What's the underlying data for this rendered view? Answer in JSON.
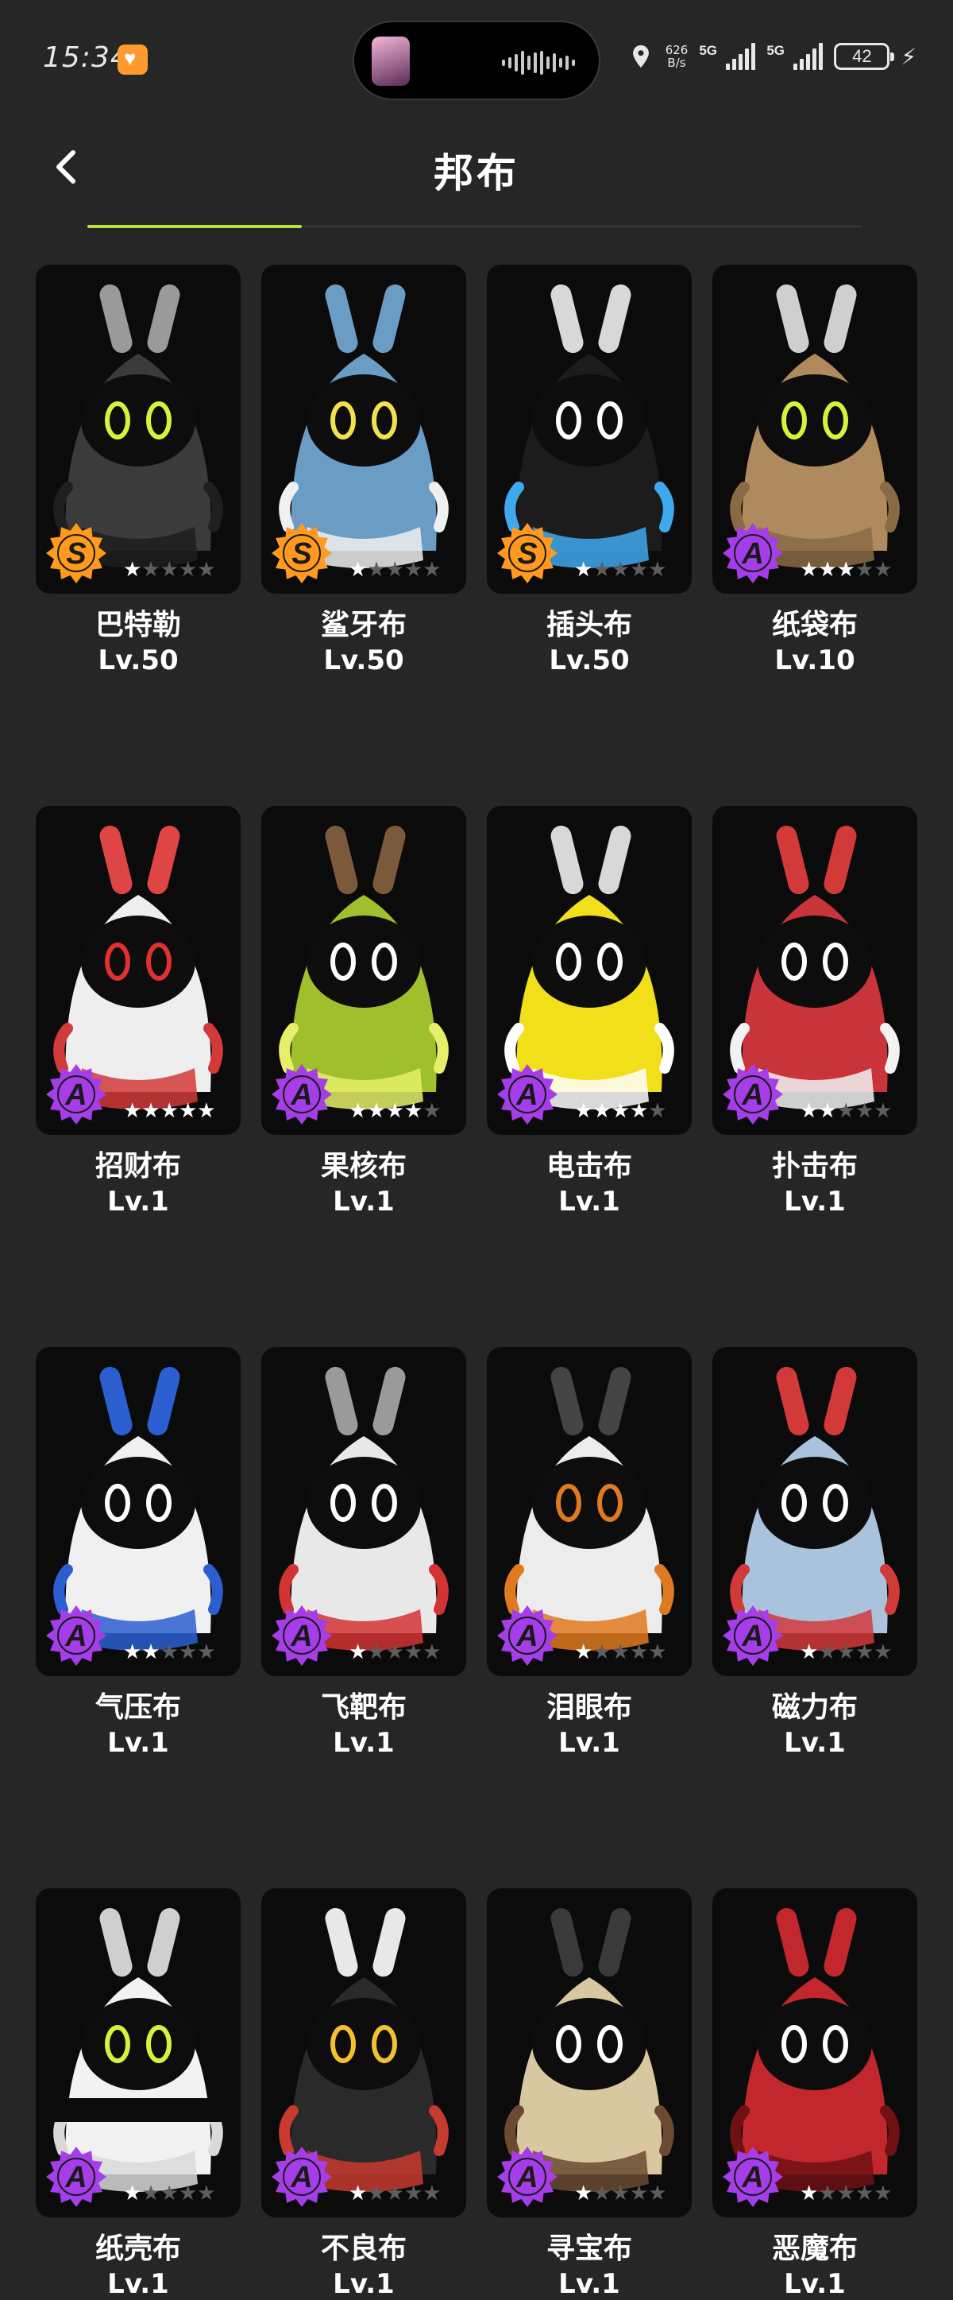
{
  "status_bar": {
    "time": "15:34",
    "net_speed_value": "626",
    "net_speed_unit": "B/s",
    "signal_1_label": "5G",
    "signal_2_label": "5G",
    "battery_level": "42"
  },
  "header": {
    "title": "邦布",
    "back_icon": "chevron-left-icon"
  },
  "colors": {
    "background": "#262626",
    "card_bg": "#0b0b0b",
    "accent_tab": "#b9e52b",
    "rank_s": "#ff9a1f",
    "rank_a": "#a53ee8",
    "star_on": "#ffffff",
    "star_off": "#5e5e5e"
  },
  "bangboos": [
    {
      "name": "巴特勒",
      "level": "Lv.50",
      "rank": "S",
      "stars": 1,
      "body": "#3b3b3b",
      "accent": "#1f1f1f",
      "ears": "#9a9a9a",
      "eyes": "#d7f23c"
    },
    {
      "name": "鲨牙布",
      "level": "Lv.50",
      "rank": "S",
      "stars": 1,
      "body": "#6a9cc4",
      "accent": "#f0f0f0",
      "ears": "#6a9cc4",
      "eyes": "#f3e04a"
    },
    {
      "name": "插头布",
      "level": "Lv.50",
      "rank": "S",
      "stars": 1,
      "body": "#1c1c1c",
      "accent": "#3fa9ee",
      "ears": "#d8d8d8",
      "eyes": "#ffffff"
    },
    {
      "name": "纸袋布",
      "level": "Lv.10",
      "rank": "A",
      "stars": 3,
      "body": "#b08a5f",
      "accent": "#8a6a45",
      "ears": "#cfcfcf",
      "eyes": "#d7f23c"
    },
    {
      "name": "招财布",
      "level": "Lv.1",
      "rank": "A",
      "stars": 5,
      "body": "#eeeeee",
      "accent": "#d23a3a",
      "ears": "#e04545",
      "eyes": "#e03030"
    },
    {
      "name": "果核布",
      "level": "Lv.1",
      "rank": "A",
      "stars": 4,
      "body": "#9fbf2c",
      "accent": "#e5ef6a",
      "ears": "#7a5a3a",
      "eyes": "#ffffff"
    },
    {
      "name": "电击布",
      "level": "Lv.1",
      "rank": "A",
      "stars": 4,
      "body": "#f1df1a",
      "accent": "#ffffff",
      "ears": "#d8d8d8",
      "eyes": "#ffffff"
    },
    {
      "name": "扑击布",
      "level": "Lv.1",
      "rank": "A",
      "stars": 2,
      "body": "#c9343b",
      "accent": "#f2f2f2",
      "ears": "#d23a3a",
      "eyes": "#ffffff"
    },
    {
      "name": "气压布",
      "level": "Lv.1",
      "rank": "A",
      "stars": 2,
      "body": "#f0f0f0",
      "accent": "#2b5fd1",
      "ears": "#2b5fd1",
      "eyes": "#ffffff"
    },
    {
      "name": "飞靶布",
      "level": "Lv.1",
      "rank": "A",
      "stars": 1,
      "body": "#e8e8e8",
      "accent": "#d43333",
      "ears": "#9a9a9a",
      "eyes": "#ffffff"
    },
    {
      "name": "泪眼布",
      "level": "Lv.1",
      "rank": "A",
      "stars": 1,
      "body": "#ececec",
      "accent": "#e07a20",
      "ears": "#444444",
      "eyes": "#e07a20"
    },
    {
      "name": "磁力布",
      "level": "Lv.1",
      "rank": "A",
      "stars": 1,
      "body": "#a9c3dd",
      "accent": "#d23a3a",
      "ears": "#d23a3a",
      "eyes": "#ffffff"
    },
    {
      "name": "纸壳布",
      "level": "Lv.1",
      "rank": "A",
      "stars": 1,
      "body": "#f2f2f2",
      "accent": "#d9d9d9",
      "ears": "#cfcfcf",
      "eyes": "#d7f23c"
    },
    {
      "name": "不良布",
      "level": "Lv.1",
      "rank": "A",
      "stars": 1,
      "body": "#2a2a2a",
      "accent": "#c73a2e",
      "ears": "#e8e8e8",
      "eyes": "#f3c130"
    },
    {
      "name": "寻宝布",
      "level": "Lv.1",
      "rank": "A",
      "stars": 1,
      "body": "#d9c7a0",
      "accent": "#6a4a30",
      "ears": "#3a3a3a",
      "eyes": "#ffffff"
    },
    {
      "name": "恶魔布",
      "level": "Lv.1",
      "rank": "A",
      "stars": 1,
      "body": "#c1272d",
      "accent": "#6e1014",
      "ears": "#c1272d",
      "eyes": "#ffffff"
    }
  ]
}
